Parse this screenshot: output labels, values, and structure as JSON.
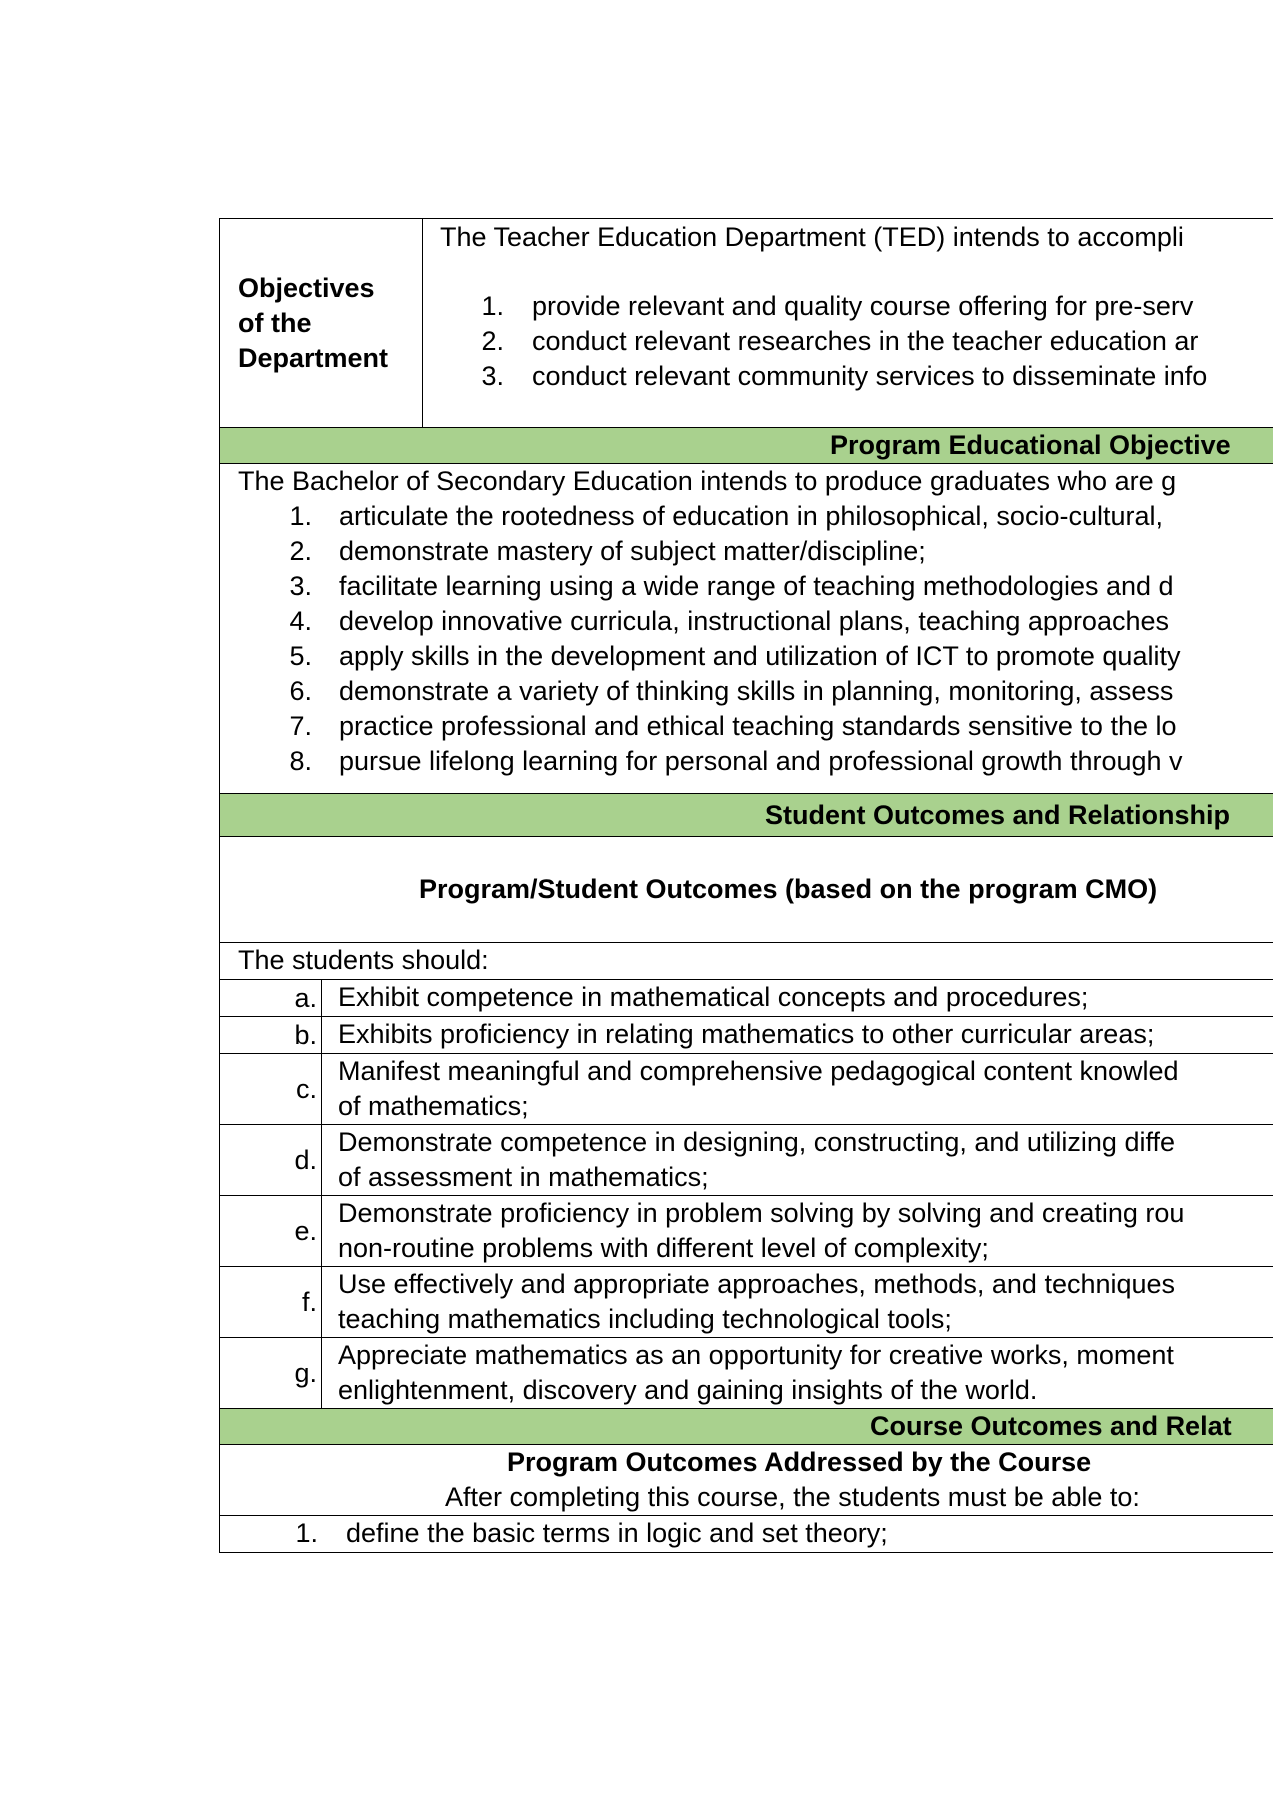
{
  "objectives": {
    "label_lines": [
      "Objectives",
      "of the",
      "Department"
    ],
    "intro": "The Teacher Education Department (TED) intends to accompli",
    "items": [
      {
        "num": "1.",
        "text": "provide relevant and quality course offering for pre-serv"
      },
      {
        "num": "2.",
        "text": "conduct relevant researches in the teacher education ar"
      },
      {
        "num": "3.",
        "text": "conduct relevant community services to disseminate info"
      }
    ]
  },
  "peo": {
    "heading": "Program Educational Objective",
    "intro": "The Bachelor of Secondary Education intends to produce graduates who are g",
    "items": [
      {
        "num": "1.",
        "text": "articulate the rootedness of education in philosophical, socio-cultural,"
      },
      {
        "num": "2.",
        "text": "demonstrate mastery of subject matter/discipline;"
      },
      {
        "num": "3.",
        "text": "facilitate learning using a wide range of teaching methodologies and d"
      },
      {
        "num": "4.",
        "text": "develop innovative curricula, instructional plans, teaching approaches"
      },
      {
        "num": "5.",
        "text": "apply skills in the development and utilization of ICT to promote quality"
      },
      {
        "num": "6.",
        "text": "demonstrate a variety of thinking skills in planning, monitoring, assess"
      },
      {
        "num": "7.",
        "text": "practice professional and ethical teaching standards sensitive to the lo"
      },
      {
        "num": "8.",
        "text": "pursue lifelong learning for personal and professional growth through v"
      }
    ]
  },
  "so": {
    "heading": "Student Outcomes and Relationship",
    "subheading": "Program/Student Outcomes (based on the program CMO)",
    "intro": "The students should:",
    "items": [
      {
        "letter": "a.",
        "lines": [
          "Exhibit competence in mathematical concepts and procedures;"
        ]
      },
      {
        "letter": "b.",
        "lines": [
          "Exhibits proficiency in relating mathematics to other curricular areas;"
        ]
      },
      {
        "letter": "c.",
        "lines": [
          "Manifest meaningful and comprehensive pedagogical content knowled",
          "of mathematics;"
        ]
      },
      {
        "letter": "d.",
        "lines": [
          "Demonstrate competence in designing, constructing, and utilizing diffe",
          "of assessment in mathematics;"
        ]
      },
      {
        "letter": "e.",
        "lines": [
          "Demonstrate proficiency in problem solving by solving and creating rou",
          "non-routine problems with different level of complexity;"
        ]
      },
      {
        "letter": "f.",
        "lines": [
          "Use effectively and appropriate approaches, methods, and techniques",
          "teaching mathematics including technological tools;"
        ]
      },
      {
        "letter": "g.",
        "lines": [
          "Appreciate mathematics as an opportunity for creative works, moment",
          "enlightenment, discovery and gaining insights of the world."
        ]
      }
    ]
  },
  "co": {
    "heading": "Course Outcomes and Relat",
    "subheading": "Program Outcomes Addressed by the Course",
    "subtext": "After completing this course, the students must be able to:",
    "items": [
      {
        "num": "1.",
        "text": "define the basic terms in logic and set theory;"
      }
    ]
  }
}
